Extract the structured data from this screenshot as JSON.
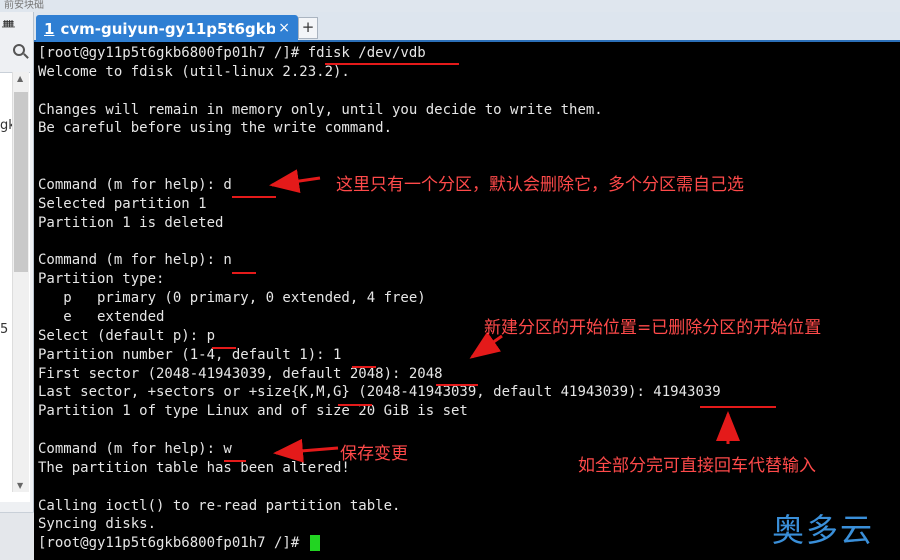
{
  "window": {
    "top_strip_text": "前安块础"
  },
  "sidebar": {
    "pin_glyph": "ᚙ",
    "snippet_1": "gk",
    "snippet_2": "5"
  },
  "tab": {
    "index": "1",
    "title": "cvm-guiyun-gy11p5t6gkb...",
    "close_glyph": "×",
    "new_tab_glyph": "+"
  },
  "terminal": {
    "lines": [
      "[root@gy11p5t6gkb6800fp01h7 /]# fdisk /dev/vdb",
      "Welcome to fdisk (util-linux 2.23.2).",
      "",
      "Changes will remain in memory only, until you decide to write them.",
      "Be careful before using the write command.",
      "",
      "",
      "Command (m for help): d",
      "Selected partition 1",
      "Partition 1 is deleted",
      "",
      "Command (m for help): n",
      "Partition type:",
      "   p   primary (0 primary, 0 extended, 4 free)",
      "   e   extended",
      "Select (default p): p",
      "Partition number (1-4, default 1): 1",
      "First sector (2048-41943039, default 2048): 2048",
      "Last sector, +sectors or +size{K,M,G} (2048-41943039, default 41943039): 41943039",
      "Partition 1 of type Linux and of size 20 GiB is set",
      "",
      "Command (m for help): w",
      "The partition table has been altered!",
      "",
      "Calling ioctl() to re-read partition table.",
      "Syncing disks.",
      "[root@gy11p5t6gkb6800fp01h7 /]# "
    ]
  },
  "annotations": {
    "delete_note": "这里只有一个分区，默认会删除它，多个分区需自己选",
    "start_note": "新建分区的开始位置=已删除分区的开始位置",
    "save_note": "保存变更",
    "enter_note": "如全部分完可直接回车代替输入"
  },
  "watermark": "奥多云",
  "colors": {
    "terminal_bg": "#000000",
    "terminal_text": "#e6e6e6",
    "cursor": "#22d422",
    "annotation": "#ff4a4a",
    "tab_active": "#2f7fd3",
    "watermark": "#3a8fd9"
  }
}
